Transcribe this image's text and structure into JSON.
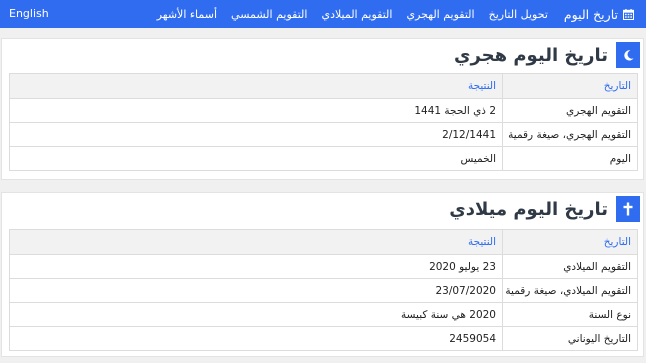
{
  "nav": {
    "items": [
      {
        "name": "nav-today-date",
        "label": "تاريخ اليوم",
        "icon": "calendar-icon"
      },
      {
        "name": "nav-date-conversion",
        "label": "تحويل التاريخ"
      },
      {
        "name": "nav-hijri-calendar",
        "label": "التقويم الهجري"
      },
      {
        "name": "nav-gregorian-calendar",
        "label": "التقويم الميلادي"
      },
      {
        "name": "nav-solar-calendar",
        "label": "التقويم الشمسي"
      },
      {
        "name": "nav-month-names",
        "label": "أسماء الأشهر"
      }
    ],
    "language": "English"
  },
  "hijri": {
    "title": "تاريخ اليوم هجري",
    "icon": "crescent-moon-icon",
    "headers": {
      "label": "التاريخ",
      "value": "النتيجة"
    },
    "rows": [
      {
        "label": "التقويم الهجري",
        "value": "2 ذي الحجة 1441"
      },
      {
        "label": "التقويم الهجري، صيغة رقمية",
        "value": "2/12/1441"
      },
      {
        "label": "اليوم",
        "value": "الخميس"
      }
    ]
  },
  "gregorian": {
    "title": "تاريخ اليوم ميلادي",
    "icon": "cross-icon",
    "headers": {
      "label": "التاريخ",
      "value": "النتيجة"
    },
    "rows": [
      {
        "label": "التقويم الميلادي",
        "value": "23 يوليو 2020"
      },
      {
        "label": "التقويم الميلادي، صيغة رقمية",
        "value": "23/07/2020"
      },
      {
        "label": "نوع السنة",
        "value": "2020 هي سنة كبيسة"
      },
      {
        "label": "التاريخ اليوناني",
        "value": "2459054"
      }
    ]
  },
  "colors": {
    "accent": "#2f6cf0"
  }
}
